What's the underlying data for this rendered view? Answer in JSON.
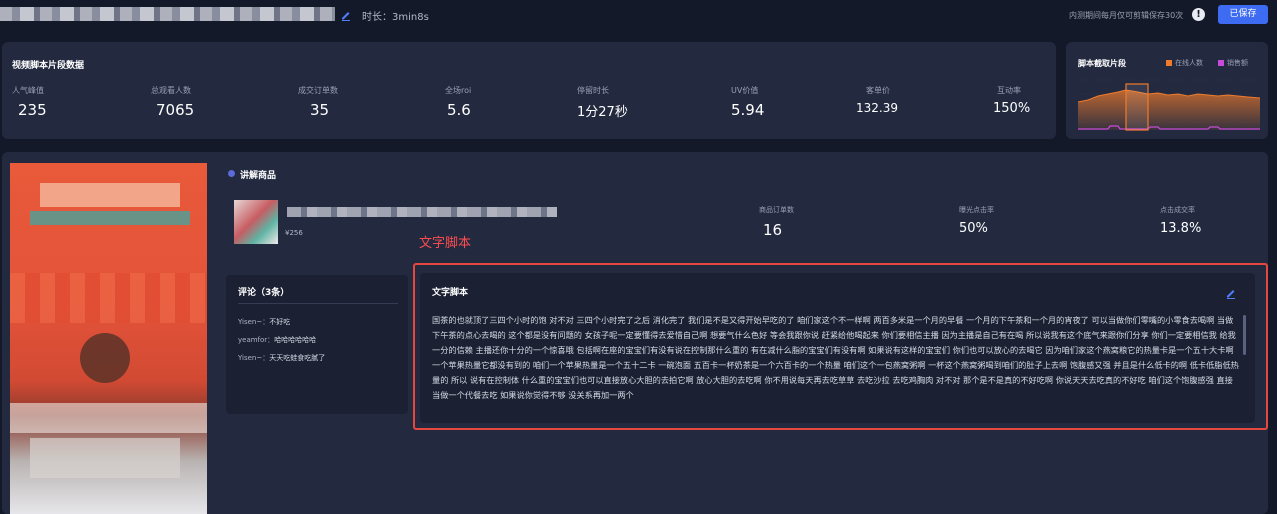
{
  "header": {
    "duration": "时长：3min8s",
    "save_note": "内测期间每月仅可剪辑保存30次",
    "warn_symbol": "!",
    "saved_button": "已保存"
  },
  "stats": {
    "title": "视频脚本片段数据",
    "items": [
      {
        "label": "人气峰值",
        "value": "235"
      },
      {
        "label": "总观看人数",
        "value": "7065"
      },
      {
        "label": "成交订单数",
        "value": "35"
      },
      {
        "label": "全场roi",
        "value": "5.6"
      },
      {
        "label": "停留时长",
        "value": "1分27秒"
      },
      {
        "label": "UV价值",
        "value": "5.94"
      },
      {
        "label": "客单价",
        "value": "132.39"
      },
      {
        "label": "互动率",
        "value": "150%"
      }
    ]
  },
  "clip": {
    "title": "脚本截取片段",
    "legend": [
      {
        "name": "在线人数",
        "color": "#f07b2b"
      },
      {
        "name": "销售额",
        "color": "#c84ad8"
      }
    ]
  },
  "section": {
    "title": "讲解商品"
  },
  "product": {
    "price": "¥256",
    "metrics": [
      {
        "label": "商品订单数",
        "value": "16"
      },
      {
        "label": "曝光点击率",
        "value": "50%"
      },
      {
        "label": "点击成交率",
        "value": "13.8%"
      }
    ]
  },
  "script_tag": "文字脚本",
  "comments": {
    "title": "评论（3条）",
    "items": [
      {
        "user": "Yisen~：",
        "text": "不好吃"
      },
      {
        "user": "yeamfor：",
        "text": "哈哈哈哈哈哈"
      },
      {
        "user": "Yisen~：",
        "text": "天天吃蛙食吃腻了"
      }
    ]
  },
  "script": {
    "title": "文字脚本",
    "text": "国茶的也就顶了三四个小时的饱 对不对 三四个小时完了之后 消化完了 我们是不是又得开始早吃的了 咱们家这个不一样啊 两百多米是一个月的早餐 一个月的下午茶和一个月的宵夜了 可以当做你们零嘴的小零食去喝啊 当做下午茶的点心去喝的 这个都是没有问题的 女孩子呢一定要懂得去爱惜自己啊 想要气什么色好 等会我跟你说 赶紧给他喝起来 你们要相信主播 因为主播是自己有在喝 所以说我有这个底气来跟你们分享 你们一定要相信我 给我一分的信赖 主播还你十分的一个惊喜哦 包括啊在座的宝宝们有没有说在控制那什么重的 有在减什么脂的宝宝们有没有啊 如果说有这样的宝宝们 你们也可以放心的去喝它 因为咱们家这个燕窝粮它的热量卡是一个五十大卡啊 一个苹果热量它都没有到的 咱们一个苹果热量是一个五十二卡 一碗泡面 五百卡一杯奶茶是一个六百卡的一个热量 咱们这个一包燕窝粥啊 一杯这个燕窝粥喝到咱们的肚子上去啊 饱腹感又强 并且是什么低卡的啊 低卡低脂低热量的 所以 说有在控制体 什么重的宝宝们也可以直接放心大胆的去拍它啊 放心大胆的去吃啊 你不用说每天再去吃草草 去吃沙拉 去吃鸡胸肉 对不对 那个是不是真的不好吃啊 你说天天去吃真的不好吃 咱们这个饱腹感强 直接当做一个代餐去吃 如果说你觉得不够 没关系再加一两个"
  }
}
